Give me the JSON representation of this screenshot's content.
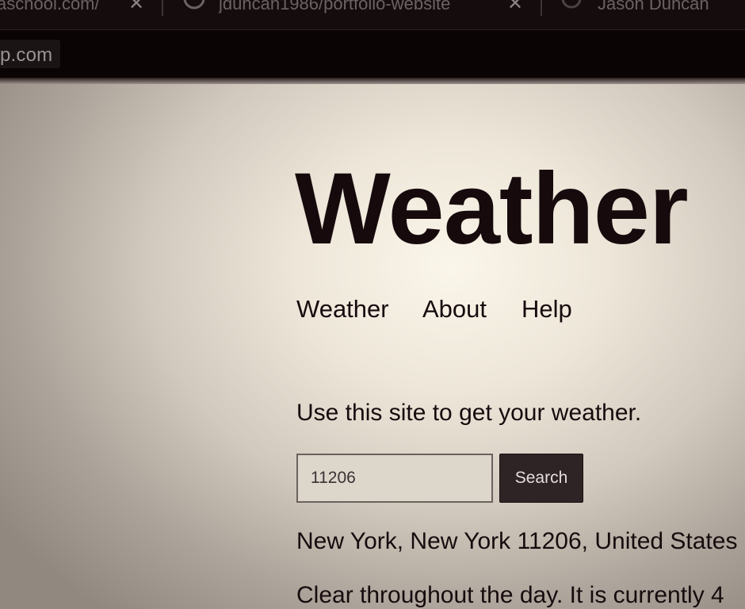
{
  "browser": {
    "tabs": [
      {
        "title": "aschool.com/"
      },
      {
        "title": "jduncan1986/portfolio-website"
      },
      {
        "title": "Jason Duncan"
      }
    ],
    "url": "p.com"
  },
  "page": {
    "title": "Weather",
    "nav": [
      {
        "label": "Weather"
      },
      {
        "label": "About"
      },
      {
        "label": "Help"
      }
    ],
    "intro": "Use this site to get your weather.",
    "search": {
      "value": "11206",
      "button_label": "Search"
    },
    "location": "New York, New York 11206, United States",
    "forecast": "Clear throughout the day. It is currently 4"
  },
  "icons": {
    "tab_close": "close-icon",
    "tab_github": "github-icon",
    "tab_profile": "profile-icon"
  }
}
